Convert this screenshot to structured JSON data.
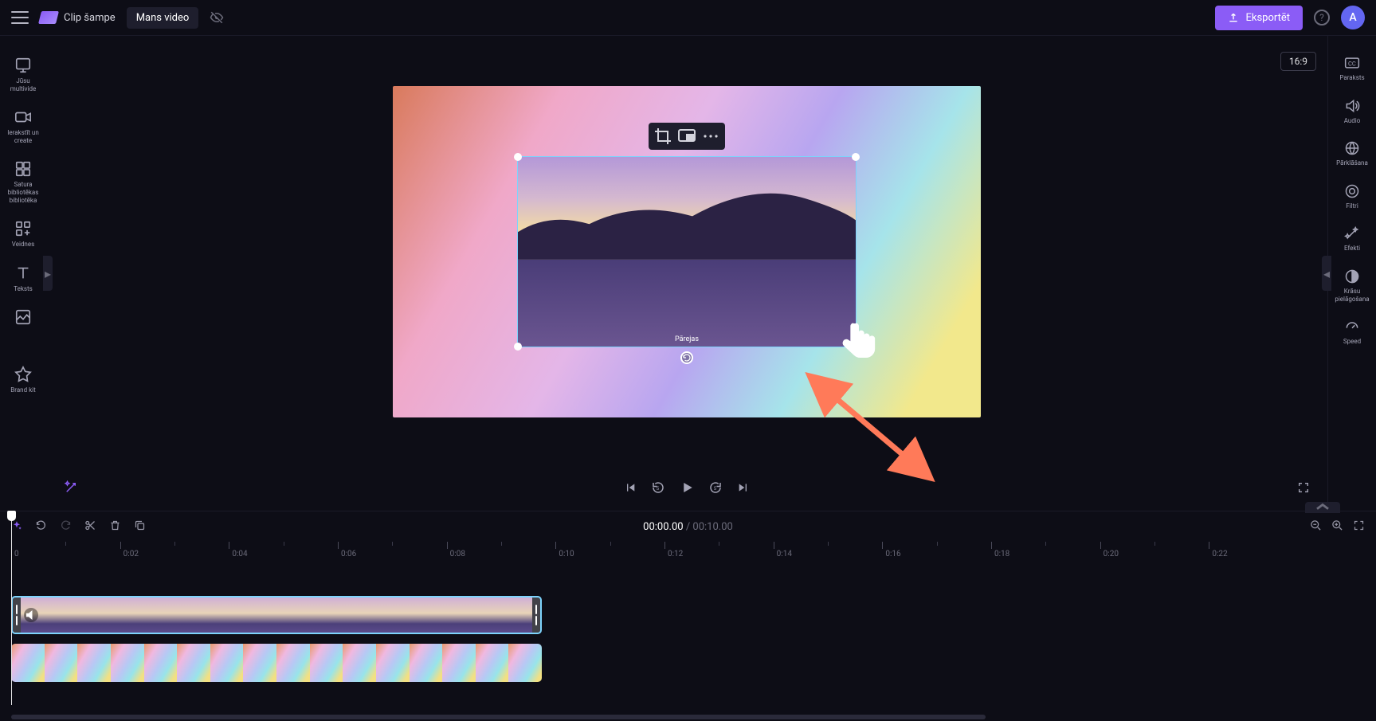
{
  "header": {
    "app_name": "Clip šampe",
    "project_name": "Mans video",
    "export_label": "Eksportēt",
    "avatar_letter": "A"
  },
  "left_sidebar": {
    "items": [
      {
        "label": "Jūsu multivide"
      },
      {
        "label": "Ierakstīt un create"
      },
      {
        "label": "Satura bibliotēkas bibliotēka"
      },
      {
        "label": "Veidnes"
      },
      {
        "label": "Teksts"
      },
      {
        "label": ""
      },
      {
        "label": "Brand kit"
      }
    ]
  },
  "canvas": {
    "ratio": "16:9",
    "selection_caption": "Pārejas"
  },
  "right_sidebar": {
    "items": [
      {
        "label": "Paraksts"
      },
      {
        "label": "Audio"
      },
      {
        "label": "Pārklāšana"
      },
      {
        "label": "Filtri"
      },
      {
        "label": "Efekti"
      },
      {
        "label": "Krāsu pielāgošana"
      },
      {
        "label": "Speed"
      }
    ]
  },
  "playback": {
    "current_time": "00:00.00",
    "duration": "00:10.00"
  },
  "ruler": {
    "ticks": [
      "0",
      "0:02",
      "0:04",
      "0:06",
      "0:08",
      "0:10",
      "0:12",
      "0:14",
      "0:16",
      "0:18",
      "0:20",
      "0:22"
    ]
  }
}
